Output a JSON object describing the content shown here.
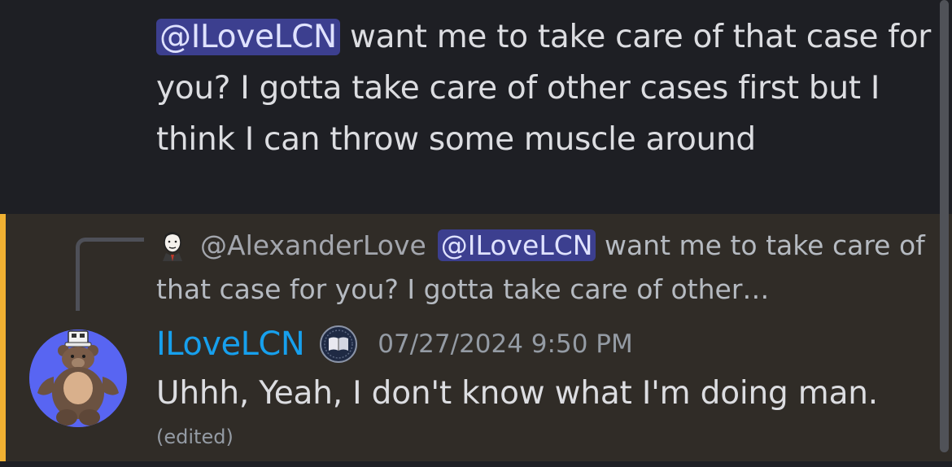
{
  "previous_message": {
    "mention": "@ILoveLCN",
    "text": " want me to take care of that case for you? I gotta take care of other cases first but I think I can throw some muscle around"
  },
  "reply": {
    "author": "@AlexanderLove",
    "mention": "@ILoveLCN",
    "preview_text": " want me to take care of that case for you? I gotta take care of other…"
  },
  "message": {
    "username": "ILoveLCN",
    "timestamp": "07/27/2024 9:50 PM",
    "text": "Uhhh, Yeah, I don't know what I'm doing man.",
    "edited_label": "(edited)"
  },
  "icons": {
    "avatar": "bear-avatar-icon",
    "small_avatar": "suited-man-avatar-icon",
    "badge": "book-badge-icon"
  },
  "colors": {
    "background": "#1e1f24",
    "highlight_background": "#302c27",
    "highlight_accent": "#f0b132",
    "mention_bg": "#3c3f8f",
    "username": "#17a0ed",
    "avatar_bg": "#5865f2"
  }
}
